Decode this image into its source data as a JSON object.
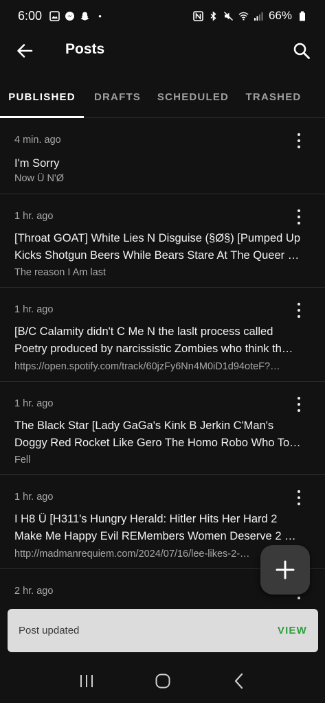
{
  "status_bar": {
    "time": "6:00",
    "dot": "•",
    "battery": "66%",
    "icons": [
      "gallery-icon",
      "messenger-icon",
      "snapchat-icon",
      "nfc-icon",
      "bluetooth-icon",
      "mute-icon",
      "wifi-icon",
      "signal-icon",
      "battery-icon"
    ]
  },
  "app_bar": {
    "title": "Posts"
  },
  "tabs": [
    {
      "label": "PUBLISHED",
      "active": true
    },
    {
      "label": "DRAFTS",
      "active": false
    },
    {
      "label": "SCHEDULED",
      "active": false
    },
    {
      "label": "TRASHED",
      "active": false
    }
  ],
  "posts": [
    {
      "time": "4 min. ago",
      "title": "I'm Sorry",
      "subtitle": "Now Ü N'Ø"
    },
    {
      "time": "1 hr. ago",
      "title": "[Throat GOAT] White Lies N Disguise (§Ø§) [Pumped Up Kicks Shotgun Beers While Bears Stare At The Queer …",
      "subtitle": "The reason I Am last"
    },
    {
      "time": "1 hr. ago",
      "title": "[B/C Calamity didn't C Me N the laslt process called Poetry produced by narcissistic Zombies who think th…",
      "subtitle": "https://open.spotify.com/track/60jzFy6Nn4M0iD1d94oteF?…"
    },
    {
      "time": "1 hr. ago",
      "title": "The Black Star [Lady GaGa's Kink B Jerkin C'Man's Doggy Red Rocket Like Gero The Homo Robo Who To…",
      "subtitle": "Fell"
    },
    {
      "time": "1 hr. ago",
      "title": "I H8 Ü [H311's Hungry Herald: Hitler Hits Her Hard 2 Make Me Happy Evil REMembers Women Deserve 2 B …",
      "subtitle": "http://madmanrequiem.com/2024/07/16/lee-likes-2-…"
    },
    {
      "time": "2 hr. ago",
      "title": "",
      "subtitle": ""
    }
  ],
  "snackbar": {
    "message": "Post updated",
    "action": "VIEW"
  },
  "colors": {
    "background": "#121212",
    "divider": "#2e2e2e",
    "snackbar_bg": "#dcdcdc",
    "snackbar_action": "#2e9e3a",
    "fab_bg": "#3a3a3a"
  }
}
